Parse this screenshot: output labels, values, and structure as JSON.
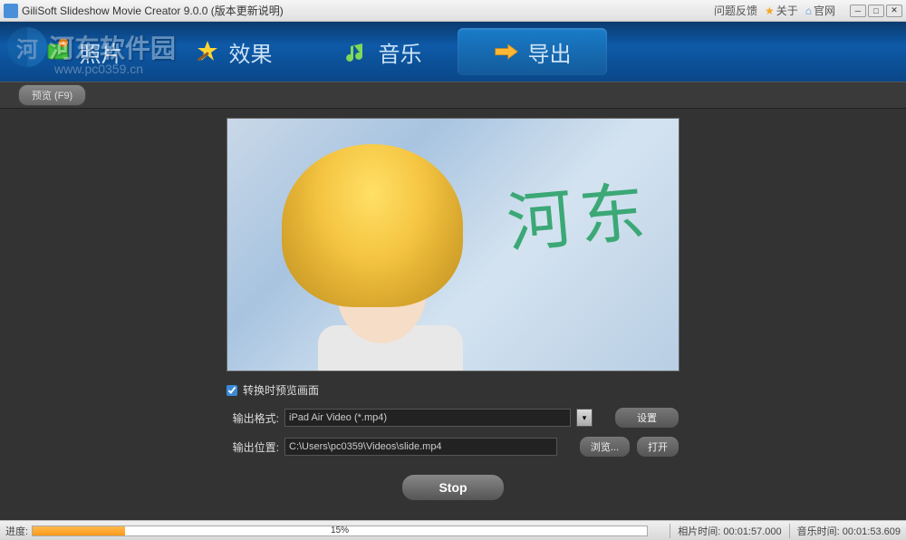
{
  "titlebar": {
    "app_title": "GiliSoft Slideshow Movie Creator 9.0.0 (版本更新说明)",
    "feedback": "问题反馈",
    "about": "关于",
    "official": "官网"
  },
  "nav": {
    "tabs": [
      {
        "label": "照片",
        "icon": "photo"
      },
      {
        "label": "效果",
        "icon": "effect"
      },
      {
        "label": "音乐",
        "icon": "music"
      },
      {
        "label": "导出",
        "icon": "export"
      }
    ],
    "active_index": 3
  },
  "toolbar": {
    "preview_label": "预览 (F9)"
  },
  "preview": {
    "handwriting": "河东",
    "checkbox_label": "转换时预览画面",
    "checkbox_checked": true
  },
  "form": {
    "format_label": "输出格式:",
    "format_value": "iPad Air Video (*.mp4)",
    "settings_button": "设置",
    "location_label": "输出位置:",
    "location_value": "C:\\Users\\pc0359\\Videos\\slide.mp4",
    "browse_button": "浏览...",
    "open_button": "打开",
    "stop_button": "Stop"
  },
  "statusbar": {
    "progress_label": "进度:",
    "progress_percent": 15,
    "progress_text": "15%",
    "photo_time_label": "相片时间:",
    "photo_time_value": "00:01:57.000",
    "music_time_label": "音乐时间:",
    "music_time_value": "00:01:53.609"
  },
  "watermark": {
    "site_name": "河东软件园",
    "site_url": "www.pc0359.cn"
  }
}
